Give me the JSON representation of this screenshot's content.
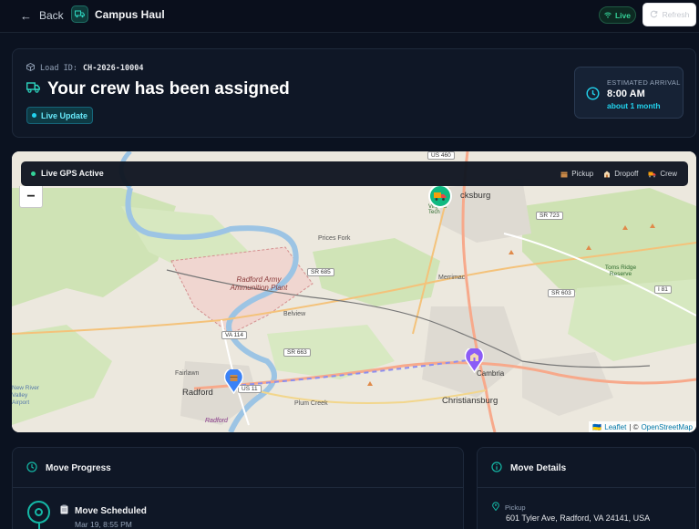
{
  "header": {
    "back_label": "Back",
    "app_title": "Campus Haul",
    "live_label": "Live",
    "refresh_label": "Refresh"
  },
  "status": {
    "load_id_label": "Load ID:",
    "load_id_value": "CH-2026-10004",
    "headline": "Your crew has been assigned",
    "badge": "Live Update",
    "eta_label": "ESTIMATED ARRIVAL",
    "eta_time": "8:00 AM",
    "eta_relative": "about 1 month"
  },
  "map": {
    "gps_status": "Live GPS Active",
    "legend": [
      {
        "icon": "package-icon",
        "label": "Pickup"
      },
      {
        "icon": "building-icon",
        "label": "Dropoff"
      },
      {
        "icon": "truck-icon",
        "label": "Crew"
      }
    ],
    "zoom_out": "−",
    "attribution": {
      "flag": "🇺🇦",
      "leaflet": "Leaflet",
      "sep": "| ©",
      "osm": "OpenStreetMap"
    },
    "labels": {
      "radford": "Radford",
      "radford_small": "Radford",
      "christiansburg": "Christiansburg",
      "cambria": "Cambria",
      "blacksburg": "cksburg",
      "virginia_tech": "Virginia Tech",
      "prices_fork": "Prices Fork",
      "merrimac": "Merrimac",
      "belview": "Belview",
      "plum_creek": "Plum Creek",
      "fairlawn": "Fairlawn",
      "army": "Radford Army Ammunition Plant",
      "park": "Toms Ridge Reserve",
      "airport": "New River Valley Airport"
    },
    "shields": {
      "sr685": "SR 685",
      "sr663": "SR 663",
      "va114": "VA 114",
      "sr723": "SR 723",
      "sr603": "SR 603",
      "i81": "I 81",
      "us11": "US 11",
      "us460": "US 460"
    },
    "markers": {
      "pickup_icon": "package-icon",
      "dropoff_icon": "building-icon",
      "crew_icon": "truck-icon"
    }
  },
  "progress": {
    "title": "Move Progress",
    "steps": [
      {
        "icon": "clipboard-icon",
        "title": "Move Scheduled",
        "date": "Mar 19, 8:55 PM"
      }
    ]
  },
  "details": {
    "title": "Move Details",
    "pickup_label": "Pickup",
    "pickup_address": "601 Tyler Ave, Radford, VA 24141, USA"
  },
  "colors": {
    "accent_teal": "#14b8a6",
    "live_green": "#34d399",
    "cyan": "#22d3ee",
    "background": "#0b1220"
  }
}
